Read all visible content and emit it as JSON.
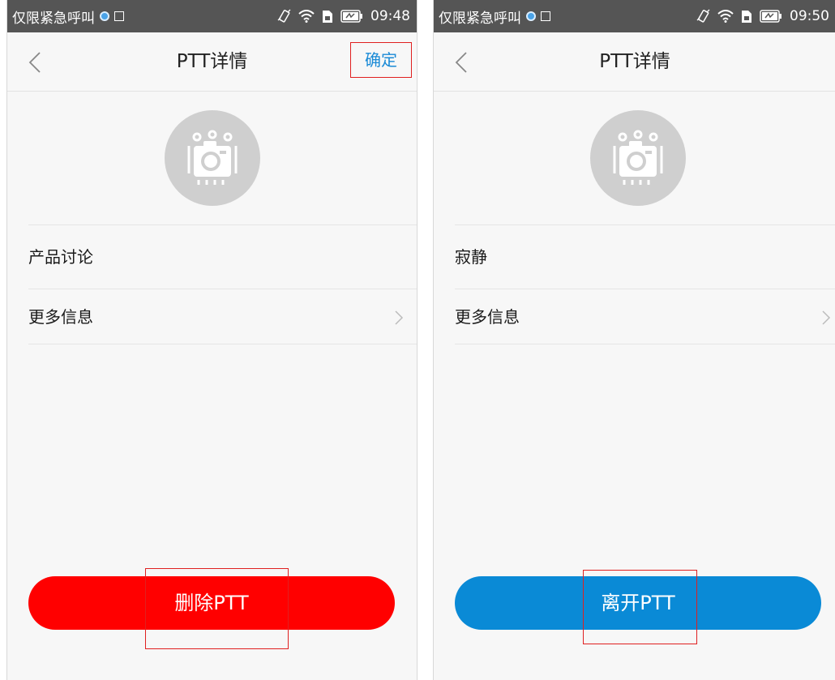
{
  "screens": [
    {
      "status": {
        "carrier": "仅限紧急呼叫",
        "time": "09:48"
      },
      "nav": {
        "title": "PTT详情",
        "confirm_label": "确定"
      },
      "group_name": "产品讨论",
      "more_info_label": "更多信息",
      "action_label": "删除PTT",
      "action_color": "#ff0000"
    },
    {
      "status": {
        "carrier": "仅限紧急呼叫",
        "time": "09:50"
      },
      "nav": {
        "title": "PTT详情"
      },
      "group_name": "寂静",
      "more_info_label": "更多信息",
      "action_label": "离开PTT",
      "action_color": "#0a8ad6"
    }
  ],
  "icons": {
    "avatar": "camera-icon",
    "back": "chevron-left-icon",
    "row_arrow": "chevron-right-icon",
    "status": [
      "app-notification-icon",
      "image-icon",
      "vibrate-icon",
      "wifi-icon",
      "sim-icon",
      "battery-icon"
    ]
  }
}
